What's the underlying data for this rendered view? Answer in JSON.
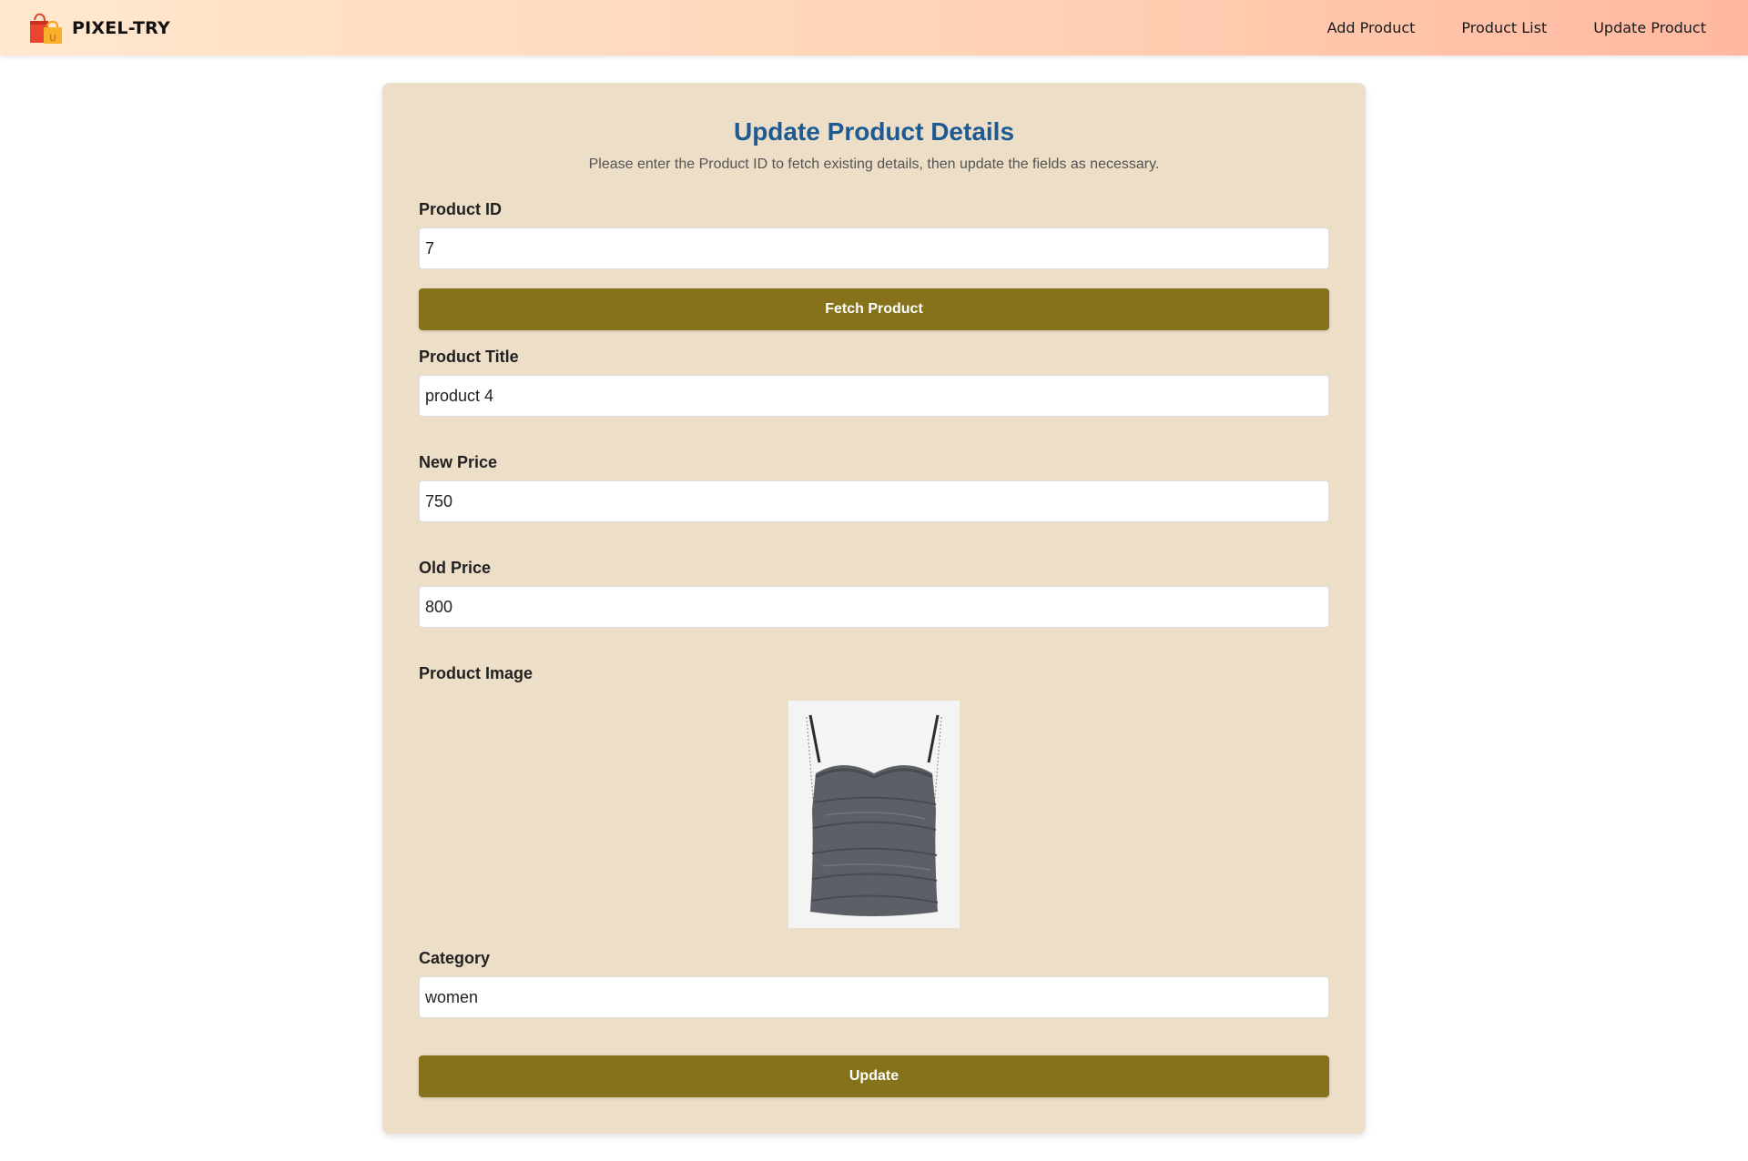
{
  "navbar": {
    "brand": "PIXEL-TRY",
    "links": [
      "Add Product",
      "Product List",
      "Update Product"
    ]
  },
  "form": {
    "title": "Update Product Details",
    "subtitle": "Please enter the Product ID to fetch existing details, then update the fields as necessary.",
    "product_id": {
      "label": "Product ID",
      "value": "7"
    },
    "fetch_button": "Fetch Product",
    "product_title": {
      "label": "Product Title",
      "value": "product 4"
    },
    "new_price": {
      "label": "New Price",
      "value": "750"
    },
    "old_price": {
      "label": "Old Price",
      "value": "800"
    },
    "product_image": {
      "label": "Product Image"
    },
    "category": {
      "label": "Category",
      "value": "women"
    },
    "update_button": "Update"
  },
  "colors": {
    "accent_button": "#86721a",
    "title": "#1d5a94",
    "card_background": "#ecdec7"
  }
}
